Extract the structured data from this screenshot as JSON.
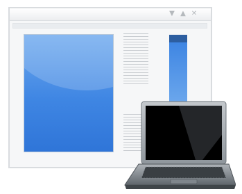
{
  "window": {
    "controls": [
      {
        "icon": "triangle-down-icon",
        "glyph": "▼"
      },
      {
        "icon": "triangle-up-icon",
        "glyph": "▲"
      },
      {
        "icon": "close-icon",
        "glyph": "✕"
      }
    ]
  },
  "colors": {
    "accent": "#3f86e3",
    "accent_dark": "#2d5ea0",
    "frame": "#d9dcdf",
    "laptop_body": "#8f969c",
    "screen": "#000000"
  }
}
